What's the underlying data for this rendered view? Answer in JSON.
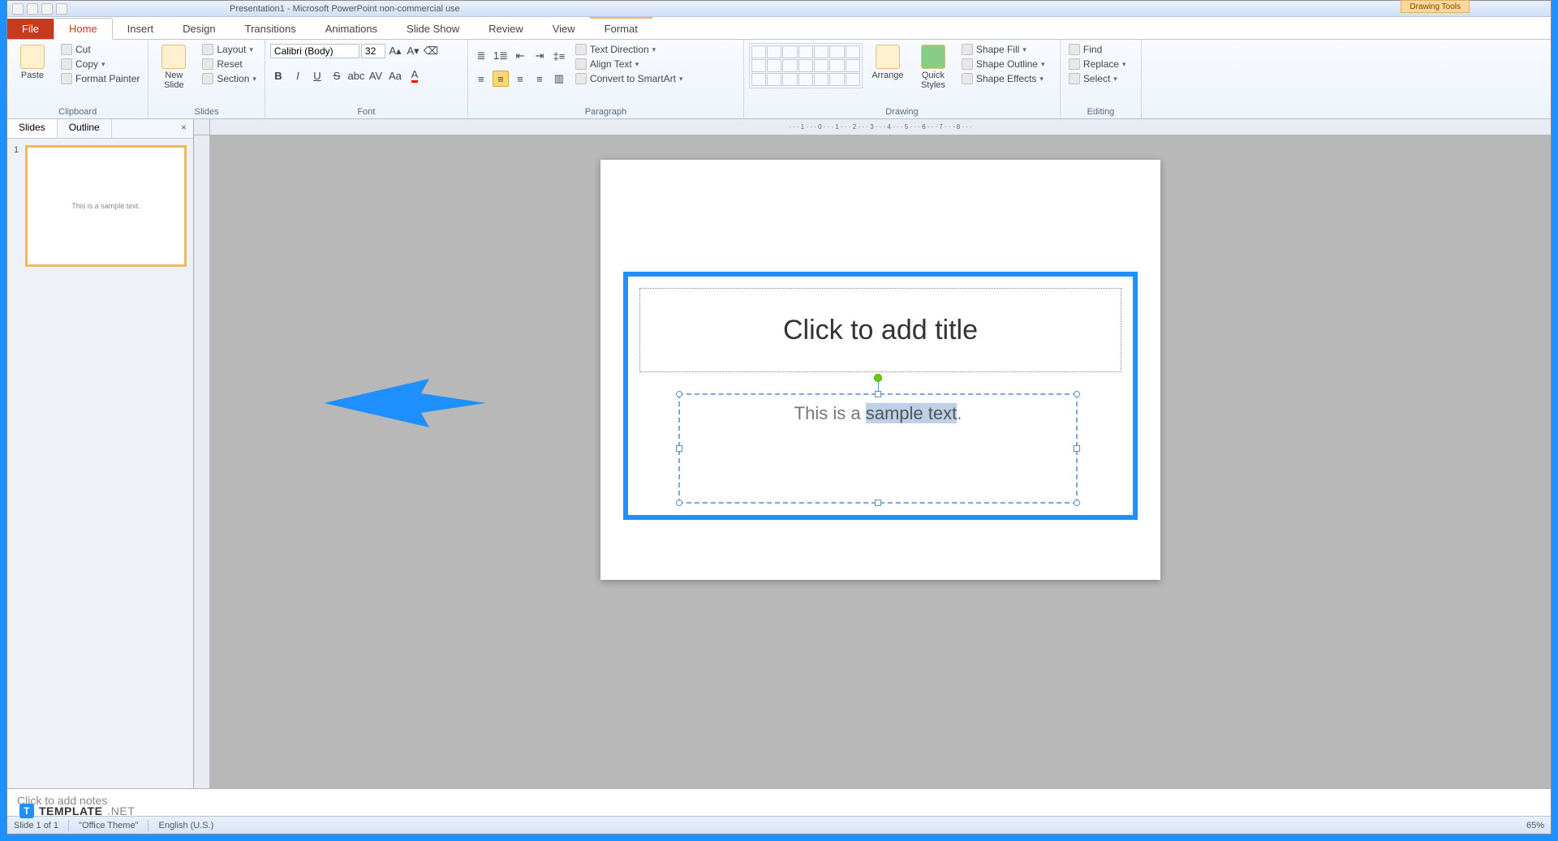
{
  "title": "Presentation1 - Microsoft PowerPoint non-commercial use",
  "contextual_tab": "Drawing Tools",
  "tabs": {
    "file": "File",
    "home": "Home",
    "insert": "Insert",
    "design": "Design",
    "transitions": "Transitions",
    "animations": "Animations",
    "slideshow": "Slide Show",
    "review": "Review",
    "view": "View",
    "format": "Format"
  },
  "clipboard": {
    "paste": "Paste",
    "cut": "Cut",
    "copy": "Copy",
    "fp": "Format Painter",
    "label": "Clipboard"
  },
  "slides": {
    "new": "New\nSlide",
    "layout": "Layout",
    "reset": "Reset",
    "section": "Section",
    "label": "Slides"
  },
  "font": {
    "name": "Calibri (Body)",
    "size": "32",
    "label": "Font"
  },
  "paragraph": {
    "dir": "Text Direction",
    "align": "Align Text",
    "smart": "Convert to SmartArt",
    "label": "Paragraph"
  },
  "drawing": {
    "arrange": "Arrange",
    "quick": "Quick\nStyles",
    "fill": "Shape Fill",
    "outline": "Shape Outline",
    "effects": "Shape Effects",
    "label": "Drawing"
  },
  "editing": {
    "find": "Find",
    "replace": "Replace",
    "select": "Select",
    "label": "Editing"
  },
  "panel": {
    "slides": "Slides",
    "outline": "Outline",
    "thumb_text": "This is a sample text."
  },
  "slide": {
    "title_ph": "Click to add title",
    "sub_pre": "This is a ",
    "sub_sel": "sample text",
    "sub_post": "."
  },
  "notes": "Click to add notes",
  "status": {
    "slide": "Slide 1 of 1",
    "theme": "\"Office Theme\"",
    "lang": "English (U.S.)",
    "zoom": "65%"
  },
  "watermark": {
    "brand": "TEMPLATE",
    "suffix": ".NET"
  }
}
